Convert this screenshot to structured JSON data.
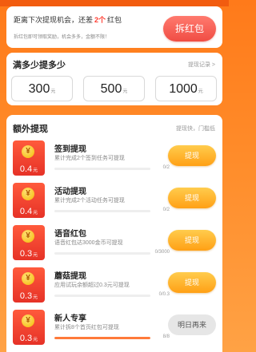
{
  "banner": {
    "prefix": "距离下次提现机会，还差",
    "count": "2个",
    "suffix": "红包",
    "hint": "拆红包即可领取奖励，机会多多，金额不限！",
    "button": "拆红包"
  },
  "threshold": {
    "title": "满多少提多少",
    "link": "提现记录 >",
    "amounts": [
      {
        "value": "300",
        "unit": "元"
      },
      {
        "value": "500",
        "unit": "元"
      },
      {
        "value": "1000",
        "unit": "元"
      }
    ]
  },
  "extra": {
    "title": "额外提现",
    "link": "提现快，门槛低",
    "coin_glyph": "¥",
    "tasks": [
      {
        "reward": "0.4",
        "unit": "元",
        "title": "签到提现",
        "desc": "累计完成2个签到任务可提现",
        "progress": "0/2",
        "progress_fraction": 0,
        "button": "提现",
        "state": "active"
      },
      {
        "reward": "0.4",
        "unit": "元",
        "title": "活动提现",
        "desc": "累计完成2个活动任务可提现",
        "progress": "0/2",
        "progress_fraction": 0,
        "button": "提现",
        "state": "active"
      },
      {
        "reward": "0.3",
        "unit": "元",
        "title": "语音红包",
        "desc": "语音红包达3000金币可提现",
        "progress": "0/3000",
        "progress_fraction": 0,
        "button": "提现",
        "state": "active"
      },
      {
        "reward": "0.3",
        "unit": "元",
        "title": "蘑菇提现",
        "desc": "应用试玩余额超过0.3元可提现",
        "progress": "0/0.3",
        "progress_fraction": 0,
        "button": "提现",
        "state": "active"
      },
      {
        "reward": "0.3",
        "unit": "元",
        "title": "新人专享",
        "desc": "累计拆8个首页红包可提现",
        "progress": "8/8",
        "progress_fraction": 1,
        "button": "明日再来",
        "state": "disabled"
      }
    ]
  },
  "colors": {
    "accent": "#ff7a1a",
    "red": "#f04d44",
    "gold": "#ffb020"
  }
}
